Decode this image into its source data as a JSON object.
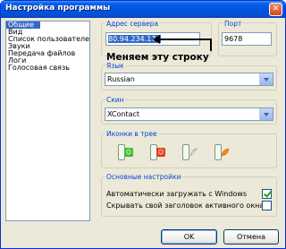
{
  "window": {
    "title": "Настройка программы",
    "close_glyph": "✕"
  },
  "sidebar": {
    "items": [
      {
        "label": "Общие",
        "selected": true
      },
      {
        "label": "Вид"
      },
      {
        "label": "Список пользователей"
      },
      {
        "label": "Звуки"
      },
      {
        "label": "Передача файлов"
      },
      {
        "label": "Логи"
      },
      {
        "label": "Голосовая связь"
      }
    ]
  },
  "server": {
    "label": "Адрес сервера",
    "value": "80.94.234.174"
  },
  "port": {
    "label": "Порт",
    "value": "9678"
  },
  "annotation": {
    "text": "Меняем эту строку"
  },
  "language": {
    "label": "Язык",
    "value": "Russian"
  },
  "skin": {
    "label": "Скин",
    "value": "XContact"
  },
  "tray": {
    "label": "Иконки в трее",
    "icons": [
      {
        "name": "green-smiley-icon",
        "color": "#3dbb2a"
      },
      {
        "name": "red-smiley-icon",
        "color": "#e03a1a"
      },
      {
        "name": "feather-icon",
        "color": "#d8d8d8"
      },
      {
        "name": "orange-leaf-icon",
        "color": "#f08a10"
      }
    ]
  },
  "basic": {
    "label": "Основные настройки",
    "autostart": {
      "label": "Автоматически загружать с Windows",
      "checked": true
    },
    "hide_title": {
      "label": "Скрывать свой заголовок активного окна",
      "checked": false
    }
  },
  "buttons": {
    "ok": "OK",
    "cancel": "Отмена"
  },
  "colors": {
    "titlebar": "#0054e3",
    "selection": "#316ac5",
    "group_label": "#0046d5"
  }
}
